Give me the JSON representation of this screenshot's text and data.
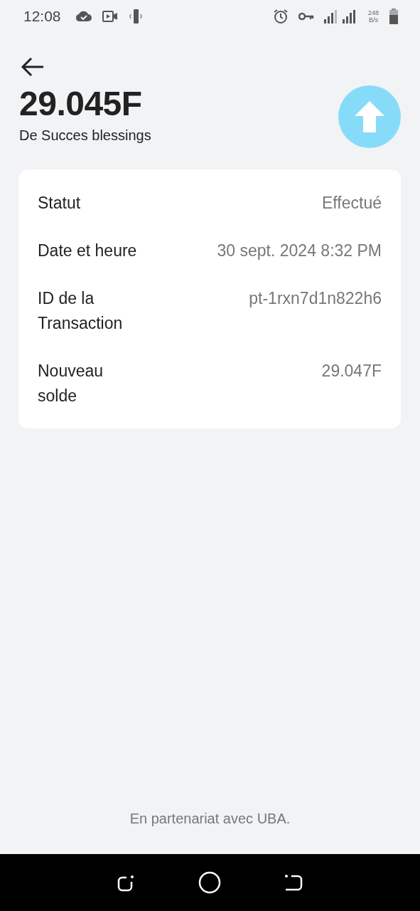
{
  "status_bar": {
    "time": "12:08",
    "net_speed": "248",
    "net_unit": "B/s"
  },
  "amount": "29.045F",
  "counterparty": "De Succes blessings",
  "details": [
    {
      "label": "Statut",
      "value": "Effectué"
    },
    {
      "label": "Date et heure",
      "value": "30 sept. 2024 8:32 PM"
    },
    {
      "label": "ID de la Transaction",
      "value": "pt-1rxn7d1n822h6"
    },
    {
      "label": "Nouveau solde",
      "value": "29.047F"
    }
  ],
  "footer": "En partenariat avec UBA."
}
